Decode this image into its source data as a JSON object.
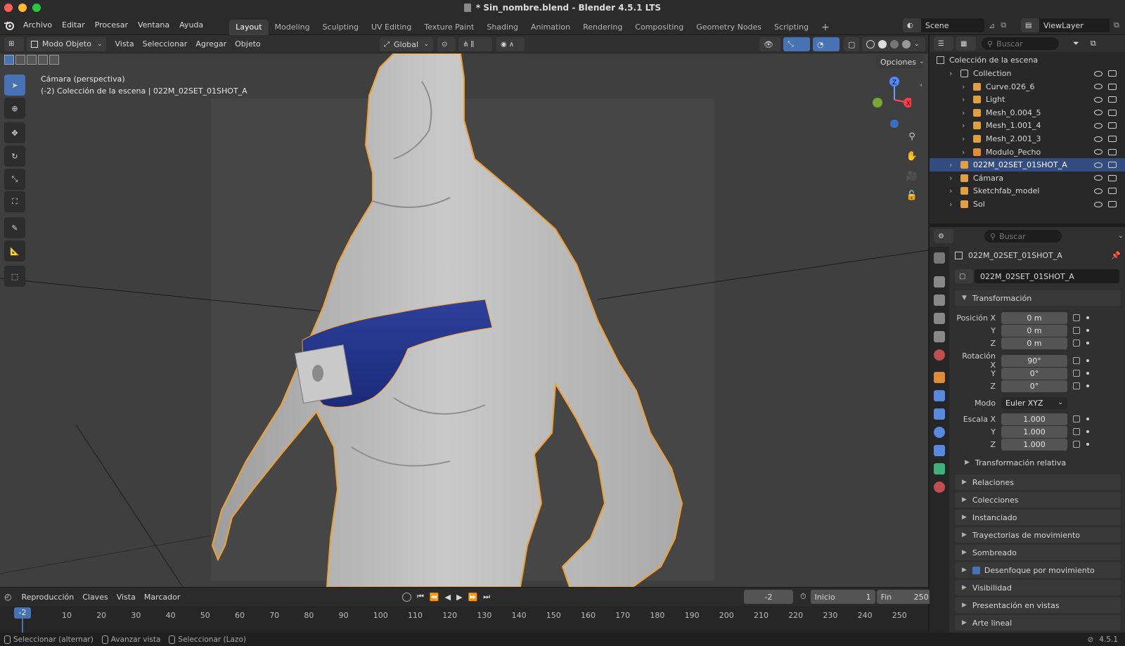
{
  "window": {
    "title": "* Sin_nombre.blend - Blender 4.5.1 LTS"
  },
  "menu": [
    "Archivo",
    "Editar",
    "Procesar",
    "Ventana",
    "Ayuda"
  ],
  "workspaces": [
    "Layout",
    "Modeling",
    "Sculpting",
    "UV Editing",
    "Texture Paint",
    "Shading",
    "Animation",
    "Rendering",
    "Compositing",
    "Geometry Nodes",
    "Scripting"
  ],
  "active_workspace": "Layout",
  "scene": {
    "name": "Scene",
    "view_layer": "ViewLayer"
  },
  "viewport": {
    "mode": "Modo Objeto",
    "menus": [
      "Vista",
      "Seleccionar",
      "Agregar",
      "Objeto"
    ],
    "transform_orientation": "Global",
    "options_label": "Opciones",
    "info_line1": "Cámara (perspectiva)",
    "info_line2": "(-2) Colección de la escena | 022M_02SET_01SHOT_A",
    "gizmo_x": "X",
    "gizmo_z": "Z"
  },
  "timeline": {
    "menus": [
      "Reproducción",
      "Claves",
      "Vista",
      "Marcador"
    ],
    "current_frame": "-2",
    "start_label": "Inicio",
    "start_value": "1",
    "end_label": "Fin",
    "end_value": "250",
    "ticks": [
      "-2",
      "10",
      "20",
      "30",
      "40",
      "50",
      "60",
      "70",
      "80",
      "90",
      "100",
      "110",
      "120",
      "130",
      "140",
      "150",
      "160",
      "170",
      "180",
      "190",
      "200",
      "210",
      "220",
      "230",
      "240",
      "250"
    ]
  },
  "outliner": {
    "search_placeholder": "Buscar",
    "root": "Colección de la escena",
    "rows": [
      {
        "label": "Collection",
        "indent": 1
      },
      {
        "label": "Curve.026_6",
        "indent": 2
      },
      {
        "label": "Light",
        "indent": 2
      },
      {
        "label": "Mesh_0.004_5",
        "indent": 2
      },
      {
        "label": "Mesh_1.001_4",
        "indent": 2
      },
      {
        "label": "Mesh_2.001_3",
        "indent": 2
      },
      {
        "label": "Modulo_Pecho",
        "indent": 2
      },
      {
        "label": "022M_02SET_01SHOT_A",
        "indent": 1,
        "selected": true
      },
      {
        "label": "Cámara",
        "indent": 1
      },
      {
        "label": "Sketchfab_model",
        "indent": 1
      },
      {
        "label": "Sol",
        "indent": 1
      }
    ]
  },
  "properties": {
    "search_placeholder": "Buscar",
    "object_name": "022M_02SET_01SHOT_A",
    "object_field": "022M_02SET_01SHOT_A",
    "transform_header": "Transformación",
    "position_label": "Posición X",
    "rotation_label": "Rotación X",
    "scale_label": "Escala X",
    "y_label": "Y",
    "z_label": "Z",
    "mode_label": "Modo",
    "mode_value": "Euler XYZ",
    "position": [
      "0 m",
      "0 m",
      "0 m"
    ],
    "rotation": [
      "90°",
      "0°",
      "0°"
    ],
    "scale": [
      "1.000",
      "1.000",
      "1.000"
    ],
    "relative_transform": "Transformación relativa",
    "panels": [
      "Relaciones",
      "Colecciones",
      "Instanciado",
      "Trayectorias de movimiento",
      "Sombreado",
      "Desenfoque por movimiento",
      "Visibilidad",
      "Presentación en vistas",
      "Arte lineal"
    ]
  },
  "status": {
    "select_toggle": "Seleccionar (alternar)",
    "advance_view": "Avanzar vista",
    "select_lasso": "Seleccionar (Lazo)",
    "version": "4.5.1"
  }
}
